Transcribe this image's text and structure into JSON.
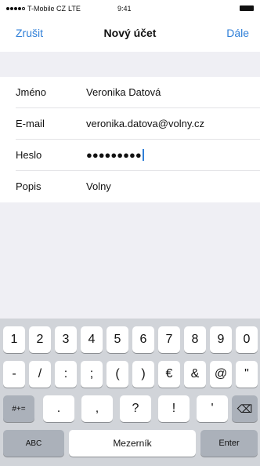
{
  "status_bar": {
    "carrier": "T-Mobile CZ",
    "network": "LTE",
    "time": "9:41"
  },
  "nav": {
    "cancel": "Zrušit",
    "title": "Nový účet",
    "next": "Dále"
  },
  "form": {
    "fields": [
      {
        "label": "Jméno",
        "value": "Veronika Datová"
      },
      {
        "label": "E-mail",
        "value": "veronika.datova@volny.cz"
      },
      {
        "label": "Heslo",
        "value": "●●●●●●●●●"
      },
      {
        "label": "Popis",
        "value": "Volny"
      }
    ]
  },
  "keyboard": {
    "row1": [
      "1",
      "2",
      "3",
      "4",
      "5",
      "6",
      "7",
      "8",
      "9",
      "0"
    ],
    "row2": [
      "-",
      "/",
      ":",
      ";",
      "(",
      ")",
      "€",
      "&",
      "@",
      "\""
    ],
    "row3_left": "#+=",
    "row3": [
      ".",
      ",",
      "?",
      "!",
      "'"
    ],
    "row3_right": "⌫",
    "abc": "ABC",
    "space": "Mezerník",
    "enter": "Enter"
  }
}
